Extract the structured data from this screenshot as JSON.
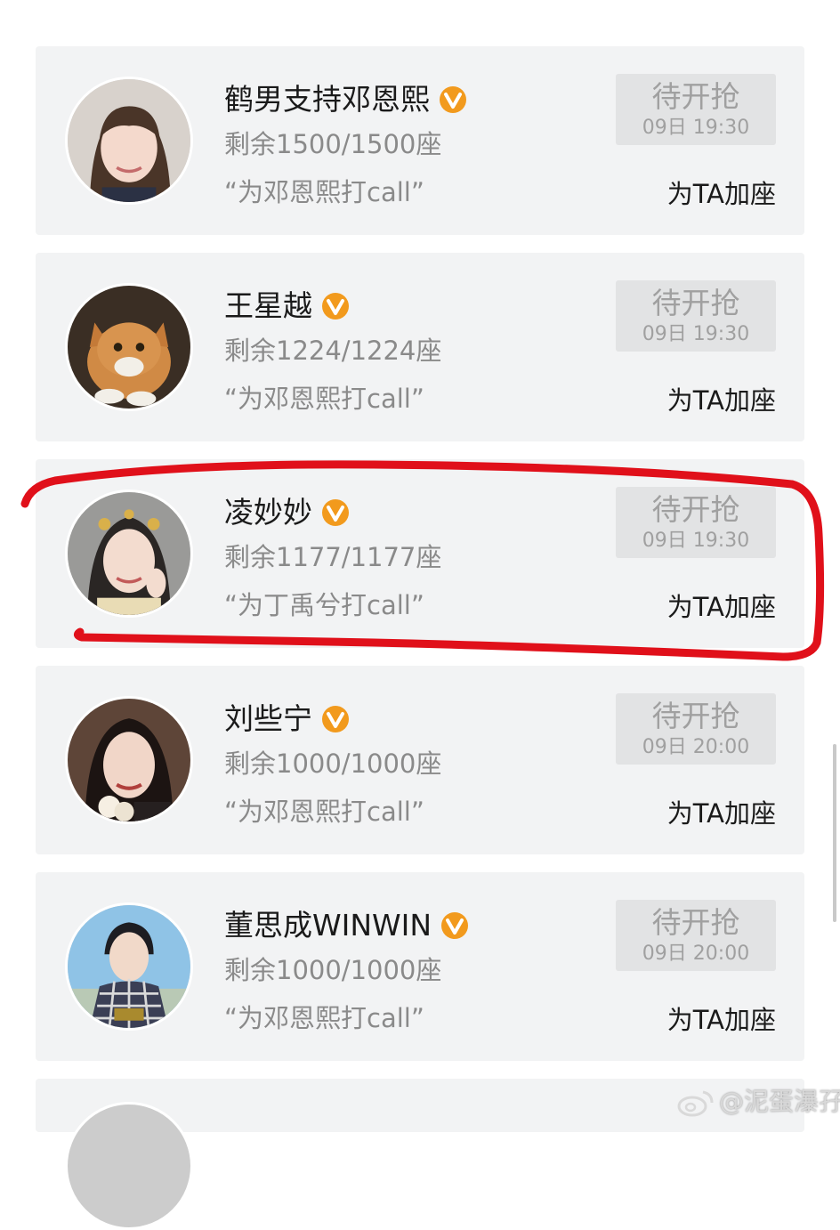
{
  "cards": [
    {
      "name": "鹤男支持邓恩熙",
      "seats": "剩余1500/1500座",
      "cheer": "“为邓恩熙打call”",
      "grab_label": "待开抢",
      "grab_time": "09日 19:30",
      "add_label": "为TA加座",
      "avatar": "avatar-woman-bangs"
    },
    {
      "name": "王星越",
      "seats": "剩余1224/1224座",
      "cheer": "“为邓恩熙打call”",
      "grab_label": "待开抢",
      "grab_time": "09日 19:30",
      "add_label": "为TA加座",
      "avatar": "avatar-orange-cat"
    },
    {
      "name": "凌妙妙",
      "seats": "剩余1177/1177座",
      "cheer": "“为丁禹兮打call”",
      "grab_label": "待开抢",
      "grab_time": "09日 19:30",
      "add_label": "为TA加座",
      "avatar": "avatar-woman-costume"
    },
    {
      "name": "刘些宁",
      "seats": "剩余1000/1000座",
      "cheer": "“为邓恩熙打call”",
      "grab_label": "待开抢",
      "grab_time": "09日 20:00",
      "add_label": "为TA加座",
      "avatar": "avatar-woman-dark-hair"
    },
    {
      "name": "董思成WINWIN",
      "seats": "剩余1000/1000座",
      "cheer": "“为邓恩熙打call”",
      "grab_label": "待开抢",
      "grab_time": "09日 20:00",
      "add_label": "为TA加座",
      "avatar": "avatar-man-plaid"
    }
  ],
  "highlight_color": "#e0101a",
  "verified_color": "#f29a1d",
  "watermark": "@泥蛋瀑孖"
}
